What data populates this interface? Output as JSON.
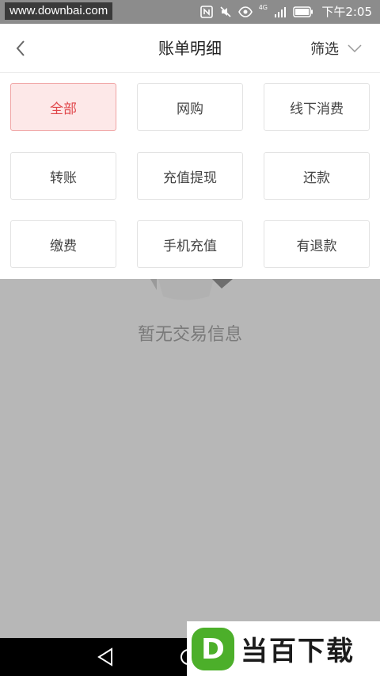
{
  "status_bar": {
    "watermark_url": "www.downbai.com",
    "signal_label": "4G",
    "time": "下午2:05"
  },
  "header": {
    "title": "账单明细",
    "filter_label": "筛选"
  },
  "filter_options": [
    {
      "label": "全部",
      "selected": true
    },
    {
      "label": "网购",
      "selected": false
    },
    {
      "label": "线下消费",
      "selected": false
    },
    {
      "label": "转账",
      "selected": false
    },
    {
      "label": "充值提现",
      "selected": false
    },
    {
      "label": "还款",
      "selected": false
    },
    {
      "label": "缴费",
      "selected": false
    },
    {
      "label": "手机充值",
      "selected": false
    },
    {
      "label": "有退款",
      "selected": false
    }
  ],
  "empty_state": {
    "message": "暂无交易信息"
  },
  "watermark": {
    "brand": "当百下载",
    "logo_letter": "D"
  },
  "colors": {
    "accent": "#e0464a",
    "accent_bg": "#fde8e8",
    "overlay": "#b7b7b7",
    "logo_green": "#4caf2a"
  }
}
